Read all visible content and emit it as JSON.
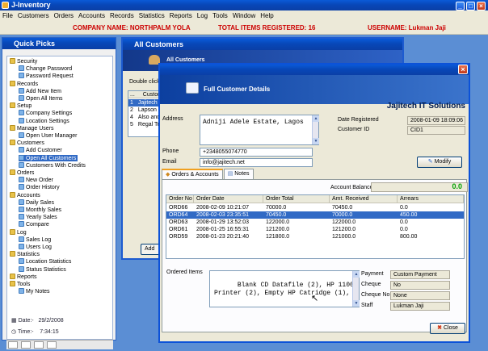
{
  "app": {
    "title": "J-Inventory"
  },
  "menu": [
    "File",
    "Customers",
    "Orders",
    "Accounts",
    "Records",
    "Statistics",
    "Reports",
    "Log",
    "Tools",
    "Window",
    "Help"
  ],
  "infobar": {
    "company": "COMPANY NAME:  NORTHPALM YOLA",
    "items": "TOTAL ITEMS REGISTERED:  16",
    "user": "USERNAME:  Lukman Jaji"
  },
  "quick_picks": {
    "title": "Quick Picks",
    "tree": [
      {
        "label": "Security",
        "type": "folder"
      },
      {
        "label": "Change Password",
        "type": "item"
      },
      {
        "label": "Password Request",
        "type": "item"
      },
      {
        "label": "Records",
        "type": "folder"
      },
      {
        "label": "Add New Item",
        "type": "item"
      },
      {
        "label": "Open All Items",
        "type": "item"
      },
      {
        "label": "Setup",
        "type": "folder"
      },
      {
        "label": "Company Settings",
        "type": "item"
      },
      {
        "label": "Location Settings",
        "type": "item"
      },
      {
        "label": "Manage Users",
        "type": "folder"
      },
      {
        "label": "Open User Manager",
        "type": "item"
      },
      {
        "label": "Customers",
        "type": "folder"
      },
      {
        "label": "Add Customer",
        "type": "item"
      },
      {
        "label": "Open All Customers",
        "type": "item",
        "selected": true
      },
      {
        "label": "Customers With Credits",
        "type": "item"
      },
      {
        "label": "Orders",
        "type": "folder"
      },
      {
        "label": "New Order",
        "type": "item"
      },
      {
        "label": "Order History",
        "type": "item"
      },
      {
        "label": "Accounts",
        "type": "folder"
      },
      {
        "label": "Daily Sales",
        "type": "item"
      },
      {
        "label": "Monthly Sales",
        "type": "item"
      },
      {
        "label": "Yearly Sales",
        "type": "item"
      },
      {
        "label": "Compare",
        "type": "item"
      },
      {
        "label": "Log",
        "type": "folder"
      },
      {
        "label": "Sales Log",
        "type": "item"
      },
      {
        "label": "Users Log",
        "type": "item"
      },
      {
        "label": "Statistics",
        "type": "folder"
      },
      {
        "label": "Location Statistics",
        "type": "item"
      },
      {
        "label": "Status Statistics",
        "type": "item"
      },
      {
        "label": "Reports",
        "type": "folder"
      },
      {
        "label": "Tools",
        "type": "folder"
      },
      {
        "label": "My Notes",
        "type": "item"
      }
    ],
    "date_label": "Date:-",
    "date_value": "29/2/2008",
    "time_label": "Time:-",
    "time_value": "7:34:15"
  },
  "all_customers": {
    "title": "All Customers",
    "band_title": "All Customers",
    "hint": "Double click c",
    "col_dots": "...",
    "col_customer": "Custom",
    "rows": [
      {
        "no": "1",
        "name": "Jajitech I"
      },
      {
        "no": "2",
        "name": "Lapson M"
      },
      {
        "no": "4",
        "name": "Also and"
      },
      {
        "no": "5",
        "name": "Regal Tel"
      }
    ],
    "add_button": "Add"
  },
  "detail": {
    "band_title": "Full Customer Details",
    "company": "Jajitech IT Solutions",
    "address_label": "Address",
    "address_value": "Adniji Adele Estate, Lagos",
    "phone_label": "Phone",
    "phone_value": "+2348055074770",
    "email_label": "Email",
    "email_value": "info@jajitech.net",
    "date_registered_label": "Date Registered",
    "date_registered_value": "2008-01-09 18:09:06",
    "customer_id_label": "Customer ID",
    "customer_id_value": "CID1",
    "modify_button": "Modify",
    "tabs": [
      "Orders & Accounts",
      "Notes"
    ],
    "account_balance_label": "Account Balance",
    "account_balance_value": "0.0",
    "columns": [
      "Order No",
      "Order Date",
      "Order Total",
      "Amt. Received",
      "Arrears"
    ],
    "orders": [
      [
        "ORD66",
        "2008-02-09 10:21:07",
        "70000.0",
        "70450.0",
        "0.0"
      ],
      [
        "ORD64",
        "2008-02-03 23:35:51",
        "70450.0",
        "70000.0",
        "450.00"
      ],
      [
        "ORD63",
        "2008-01-29 13:52:03",
        "122000.0",
        "122000.0",
        "0.0"
      ],
      [
        "ORD61",
        "2008-01-25 16:55:31",
        "121200.0",
        "121200.0",
        "0.0"
      ],
      [
        "ORD59",
        "2008-01-23 20:21:40",
        "121800.0",
        "121000.0",
        "800.00"
      ]
    ],
    "selected_order": 1,
    "ordered_items_label": "Ordered Items",
    "ordered_items_value": "Blank CD Datafile (2), HP 1100\nPrinter (2), Empty HP Catridge (1),",
    "payment_label": "Payment",
    "payment_value": "Custom Payment",
    "cheque_label": "Cheque",
    "cheque_value": "No",
    "cheque_no_label": "Cheque No",
    "cheque_no_value": "None",
    "staff_label": "Staff",
    "staff_value": "Lukman Jaji",
    "close_button": "Close",
    "colors": {
      "balance": "#00a000",
      "selection": "#316ac5",
      "close_icon": "#d03a1a"
    }
  }
}
